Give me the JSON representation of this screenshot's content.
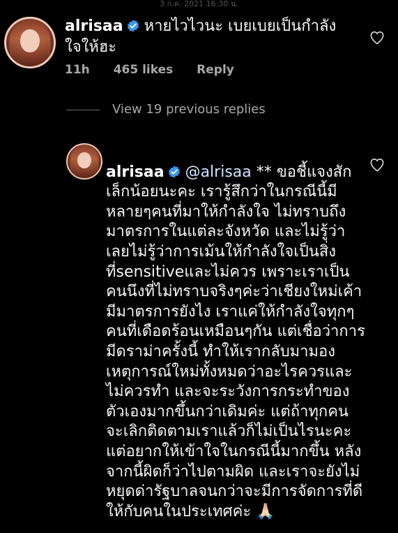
{
  "watermark": "3 ก.ค. 2021 16:30 น.",
  "main_comment": {
    "username": "alrisaa",
    "verified": true,
    "text": "หายไวไวนะ เบยเบยเป็นกำลังใจให้ฮะ",
    "time": "11h",
    "likes": "465 likes",
    "reply_label": "Reply",
    "like_icon": "heart-outline-icon"
  },
  "thread": {
    "view_replies_label": "View 19 previous replies"
  },
  "reply_comment": {
    "username": "alrisaa",
    "verified": true,
    "mention": "@alrisaa",
    "text": "** ขอชี้แจงสักเล็กน้อยนะคะ เรารู้สึกว่าในกรณีนี้มีหลายๆคนที่มาให้กำลังใจ ไม่ทราบถึงมาตรการในแต่ละจังหวัด และไม่รู้ว่า เลยไม่รู้ว่าการเม้นให้กำลังใจเป็นสิ่งที่sensitiveและไม่ควร เพราะเราเป็นคนนึงที่ไม่ทราบจริงๆค่ะว่าเชียงใหม่เค้ามีมาตรการยังไง เราแค่ให้กำลังใจทุกๆคนที่เดือดร้อนเหมือนๆกัน แต่เชื่อว่าการมีดราม่าครั้งนี้ ทำให้เรากลับมามองเหตุการณ์ใหม่ทั้งหมดว่าอะไรควรและไม่ควรทำ และจะระวังการกระทำของตัวเองมากขึ้นกว่าเดิมค่ะ แต่ถ้าทุกคนจะเลิกติดตามเราแล้วก็ไม่เป็นไรนะคะ แต่อยากให้เข้าใจในกรณีนี้มากขึ้น หลังจากนี้ผิดก็ว่าไปตามผิด และเราจะยังไม่หยุดด่ารัฐบาลจนกว่าจะมีการจัดการที่ดีให้กับคนในประเทศค่ะ 🙏🏻",
    "like_icon": "heart-outline-icon"
  },
  "colors": {
    "background": "#000000",
    "text": "#f5f5f5",
    "muted": "#a8a8a8",
    "verified": "#3897f0"
  }
}
